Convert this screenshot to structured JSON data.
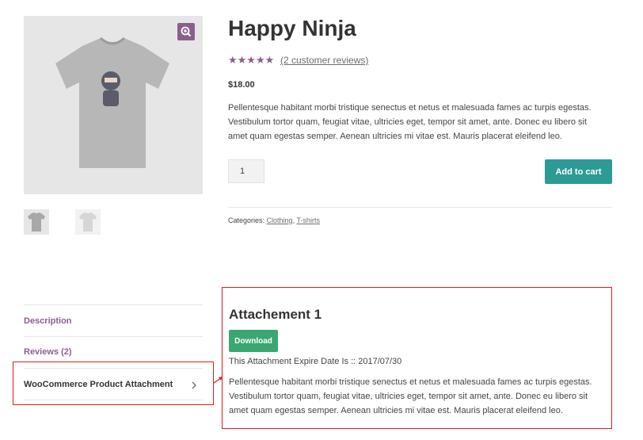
{
  "product": {
    "title": "Happy Ninja",
    "rating_stars": "★★★★★",
    "reviews_link": "(2 customer reviews)",
    "price": "$18.00",
    "description": "Pellentesque habitant morbi tristique senectus et netus et malesuada fames ac turpis egestas. Vestibulum tortor quam, feugiat vitae, ultricies eget, tempor sit amet, ante. Donec eu libero sit amet quam egestas semper. Aenean ultricies mi vitae est. Mauris placerat eleifend leo.",
    "quantity": "1",
    "add_to_cart_label": "Add to cart",
    "categories_label": "Categories:",
    "categories": [
      "Clothing",
      "T-shirts"
    ],
    "category_separator": ","
  },
  "tabs": [
    {
      "label": "Description"
    },
    {
      "label": "Reviews (2)"
    },
    {
      "label": "WooCommerce Product Attachment"
    }
  ],
  "attachment": {
    "title": "Attachement 1",
    "download_label": "Download",
    "expire_text": "This Attachment Expire Date Is :: 2017/07/30",
    "description": "Pellentesque habitant morbi tristique senectus et netus et malesuada fames ac turpis egestas. Vestibulum tortor quam, feugiat vitae, ultricies eget, tempor sit amet, ante. Donec eu libero sit amet quam egestas semper. Aenean ultricies mi vitae est. Mauris placerat eleifend leo."
  },
  "colors": {
    "accent_purple": "#8b5f8d",
    "cart_teal": "#2c9b95",
    "download_green": "#3aa772",
    "highlight_red": "#e11b1b"
  },
  "icons": {
    "zoom": "zoom-in-icon",
    "tab_chevron": "chevron-right-icon"
  }
}
